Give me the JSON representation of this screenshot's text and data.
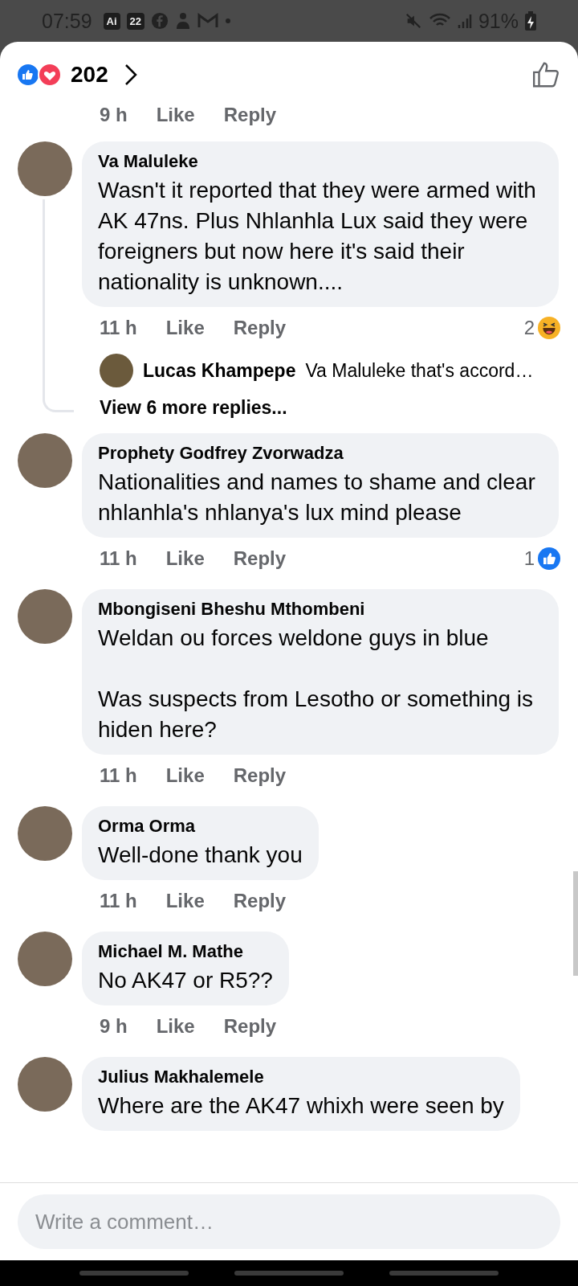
{
  "status_bar": {
    "time": "07:59",
    "notification_badges": [
      "Ai",
      "22"
    ],
    "battery": "91%"
  },
  "header": {
    "reaction_count": "202"
  },
  "previous_comment_meta": {
    "time": "9 h",
    "like": "Like",
    "reply": "Reply"
  },
  "comments": [
    {
      "name": "Va Maluleke",
      "text": "Wasn't it reported that they were armed with AK 47ns. Plus Nhlanhla Lux said they were foreigners but now here it's said their nationality is unknown....",
      "time": "11 h",
      "like": "Like",
      "reply": "Reply",
      "reaction": {
        "count": "2",
        "kind": "haha"
      },
      "reply_preview": {
        "name": "Lucas Khampepe",
        "text": "Va Maluleke that's accord…"
      },
      "more_replies": "View 6 more replies..."
    },
    {
      "name": "Prophety Godfrey Zvorwadza",
      "text": "Nationalities and names to shame and clear nhlanhla's nhlanya's lux mind please",
      "time": "11 h",
      "like": "Like",
      "reply": "Reply",
      "reaction": {
        "count": "1",
        "kind": "like"
      }
    },
    {
      "name": "Mbongiseni Bheshu Mthombeni",
      "text": "Weldan ou forces weldone guys in blue\n\nWas suspects from Lesotho or something is hiden here?",
      "time": "11 h",
      "like": "Like",
      "reply": "Reply"
    },
    {
      "name": "Orma Orma",
      "text": "Well-done thank you",
      "time": "11 h",
      "like": "Like",
      "reply": "Reply"
    },
    {
      "name": "Michael M. Mathe",
      "text": "No AK47 or R5??",
      "time": "9 h",
      "like": "Like",
      "reply": "Reply"
    },
    {
      "name": "Julius Makhalemele",
      "text": "Where are the AK47 whixh were seen by"
    }
  ],
  "composer": {
    "placeholder": "Write a comment…"
  }
}
